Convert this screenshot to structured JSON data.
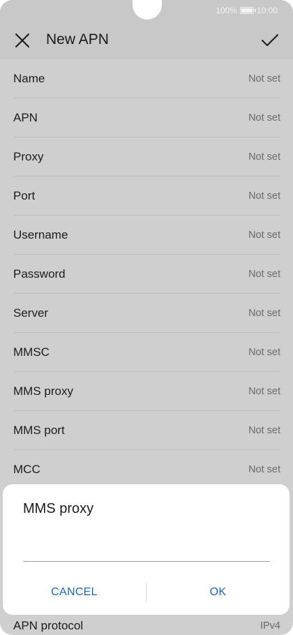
{
  "status_bar": {
    "battery_percent": "100%",
    "battery_level": 1.0,
    "time": "10:00",
    "battery_icon": "battery-icon"
  },
  "header": {
    "title": "New APN",
    "close_icon": "close-icon",
    "confirm_icon": "check-icon"
  },
  "fields": [
    {
      "label": "Name",
      "value": "Not set"
    },
    {
      "label": "APN",
      "value": "Not set"
    },
    {
      "label": "Proxy",
      "value": "Not set"
    },
    {
      "label": "Port",
      "value": "Not set"
    },
    {
      "label": "Username",
      "value": "Not set"
    },
    {
      "label": "Password",
      "value": "Not set"
    },
    {
      "label": "Server",
      "value": "Not set"
    },
    {
      "label": "MMSC",
      "value": "Not set"
    },
    {
      "label": "MMS proxy",
      "value": "Not set"
    },
    {
      "label": "MMS port",
      "value": "Not set"
    },
    {
      "label": "MCC",
      "value": "Not set"
    }
  ],
  "bottom_field": {
    "label": "APN protocol",
    "value": "IPv4"
  },
  "dialog": {
    "title": "MMS proxy",
    "input_value": "",
    "cancel_label": "CANCEL",
    "ok_label": "OK"
  },
  "colors": {
    "accent": "#1766c6",
    "overlay_background": "#cfcfcf",
    "dialog_background": "#ffffff"
  }
}
